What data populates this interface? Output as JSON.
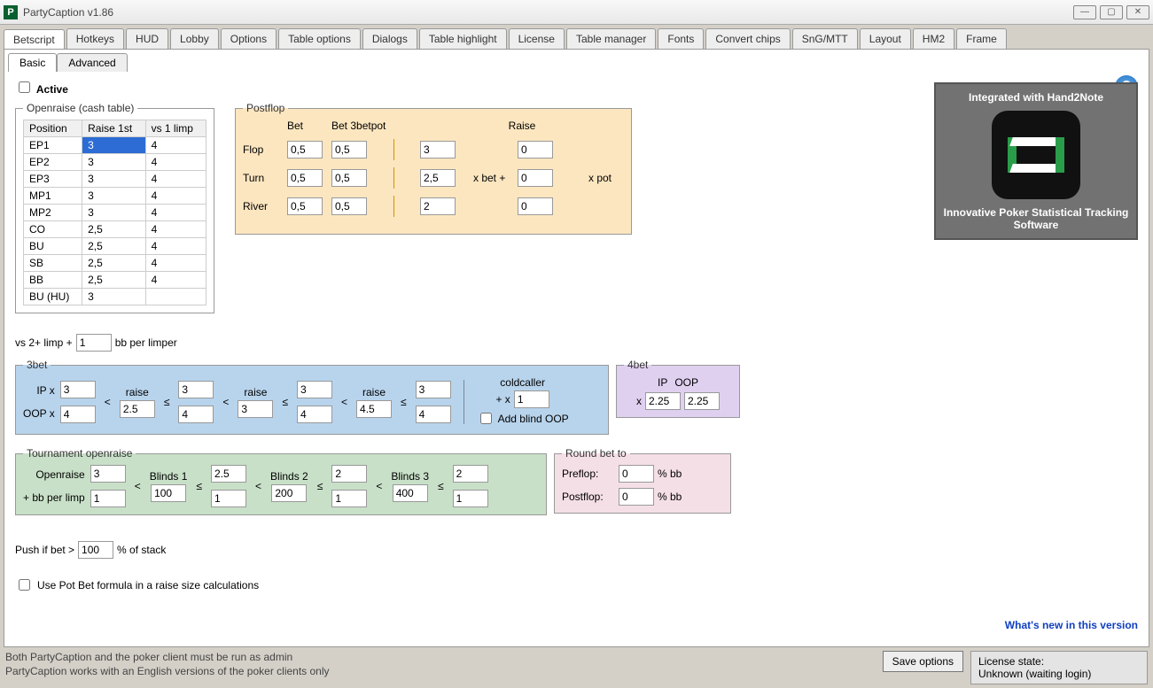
{
  "window": {
    "title": "PartyCaption v1.86"
  },
  "tabs": [
    "Betscript",
    "Hotkeys",
    "HUD",
    "Lobby",
    "Options",
    "Table options",
    "Dialogs",
    "Table highlight",
    "License",
    "Table manager",
    "Fonts",
    "Convert chips",
    "SnG/MTT",
    "Layout",
    "HM2",
    "Frame"
  ],
  "subtabs": [
    "Basic",
    "Advanced"
  ],
  "active_label": "Active",
  "openraise": {
    "legend": "Openraise (cash table)",
    "headers": [
      "Position",
      "Raise 1st",
      "vs 1 limp"
    ],
    "rows": [
      {
        "pos": "EP1",
        "r": "3",
        "v": "4"
      },
      {
        "pos": "EP2",
        "r": "3",
        "v": "4"
      },
      {
        "pos": "EP3",
        "r": "3",
        "v": "4"
      },
      {
        "pos": "MP1",
        "r": "3",
        "v": "4"
      },
      {
        "pos": "MP2",
        "r": "3",
        "v": "4"
      },
      {
        "pos": "CO",
        "r": "2,5",
        "v": "4"
      },
      {
        "pos": "BU",
        "r": "2,5",
        "v": "4"
      },
      {
        "pos": "SB",
        "r": "2,5",
        "v": "4"
      },
      {
        "pos": "BB",
        "r": "2,5",
        "v": "4"
      },
      {
        "pos": "BU (HU)",
        "r": "3",
        "v": ""
      }
    ],
    "limp_pre": "vs 2+ limp +",
    "limp_val": "1",
    "limp_suf": "bb per limper"
  },
  "postflop": {
    "legend": "Postflop",
    "hdr_bet": "Bet",
    "hdr_3bet": "Bet 3betpot",
    "hdr_raise": "Raise",
    "rows": [
      "Flop",
      "Turn",
      "River"
    ],
    "bet": [
      "0,5",
      "0,5",
      "0,5"
    ],
    "bet3": [
      "0,5",
      "0,5",
      "0,5"
    ],
    "raise1": [
      "3",
      "2,5",
      "2"
    ],
    "xbet": "x bet +",
    "raise2": [
      "0",
      "0",
      "0"
    ],
    "xpot": "x pot"
  },
  "threebet": {
    "legend": "3bet",
    "ip_lbl": "IP x",
    "oop_lbl": "OOP x",
    "ip": [
      "3",
      "3",
      "3",
      "3"
    ],
    "oop": [
      "4",
      "4",
      "4",
      "4"
    ],
    "raise_lbl": "raise",
    "raise": [
      "2.5",
      "3",
      "4.5"
    ],
    "cold_lbl": "coldcaller",
    "cold_pre": "+ x",
    "cold_val": "1",
    "blind_oop": "Add blind OOP"
  },
  "fourbet": {
    "legend": "4bet",
    "ip_lbl": "IP",
    "oop_lbl": "OOP",
    "x": "x",
    "ip": "2.25",
    "oop": "2.25"
  },
  "tourn": {
    "legend": "Tournament openraise",
    "open_lbl": "Openraise",
    "bb_lbl": "+ bb per limp",
    "open": [
      "3",
      "2.5",
      "2",
      "2"
    ],
    "limp": [
      "1",
      "1",
      "1",
      "1"
    ],
    "blinds_lbl": [
      "Blinds 1",
      "Blinds 2",
      "Blinds 3"
    ],
    "blinds": [
      "100",
      "200",
      "400"
    ]
  },
  "round": {
    "legend": "Round bet to",
    "pre_lbl": "Preflop:",
    "post_lbl": "Postflop:",
    "pre": "0",
    "post": "0",
    "suf": "% bb"
  },
  "push": {
    "pre": "Push if bet >",
    "val": "100",
    "suf": "% of stack"
  },
  "potbet": "Use Pot Bet formula in a raise size calculations",
  "ad": {
    "title": "Integrated with Hand2Note",
    "sub": "Innovative Poker Statistical Tracking Software"
  },
  "whatsnew": "What's new in this version",
  "status": {
    "l1": "Both PartyCaption and the poker client must be run as admin",
    "l2": "PartyCaption works with an English versions of the poker clients only"
  },
  "save": "Save options",
  "license": {
    "head": "License state:",
    "body": "Unknown (waiting login)"
  }
}
